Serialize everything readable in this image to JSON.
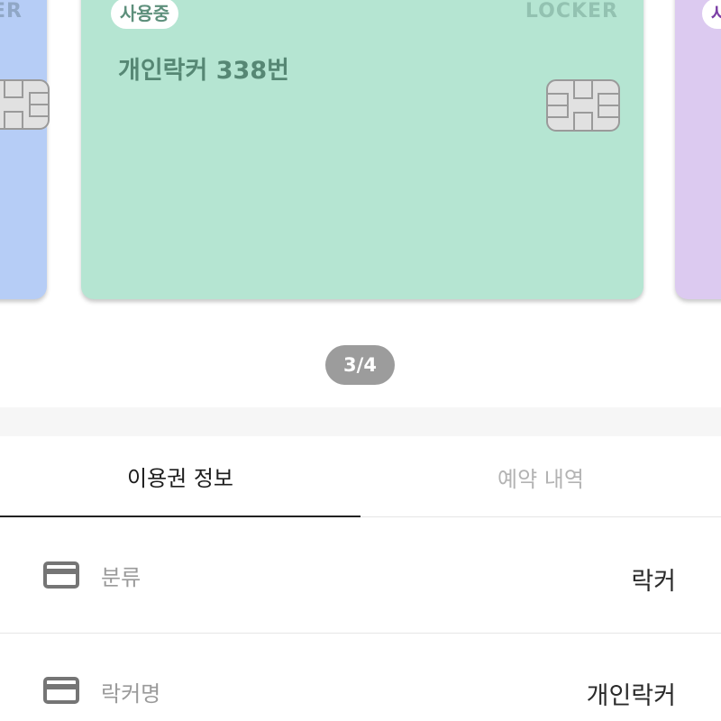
{
  "carousel": {
    "left_card": {
      "type_label": "LOCKER"
    },
    "main_card": {
      "status_badge": "사용중",
      "type_label": "LOCKER",
      "title": "개인락커 338번"
    },
    "right_card": {
      "status_badge": "사용중"
    },
    "page_indicator": "3/4"
  },
  "tabs": [
    {
      "label": "이용권 정보",
      "active": true
    },
    {
      "label": "예약 내역",
      "active": false
    }
  ],
  "info_rows": [
    {
      "icon": "credit-card-icon",
      "label": "분류",
      "value": "락커"
    },
    {
      "icon": "credit-card-icon",
      "label": "락커명",
      "value": "개인락커"
    }
  ],
  "colors": {
    "left_card": "#b6cdf6",
    "main_card": "#b5e5d2",
    "right_card": "#dccaf0",
    "indicator": "#9c9c9c",
    "active_tab_underline": "#222222"
  }
}
